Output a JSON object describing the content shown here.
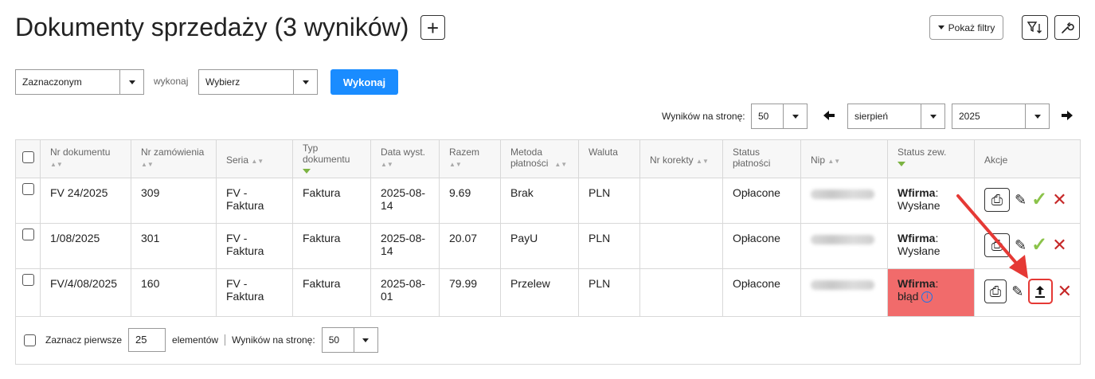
{
  "header": {
    "title": "Dokumenty sprzedaży (3 wyników)",
    "show_filters_label": "Pokaż filtry"
  },
  "bulk": {
    "scope_value": "Zaznaczonym",
    "action_label": "wykonaj",
    "action_value": "Wybierz",
    "execute_label": "Wykonaj"
  },
  "pager": {
    "per_page_label": "Wyników na stronę:",
    "per_page_value": "50",
    "month_value": "sierpień",
    "year_value": "2025"
  },
  "table": {
    "columns": [
      "Nr dokumentu",
      "Nr zamówienia",
      "Seria",
      "Typ dokumentu",
      "Data wyst.",
      "Razem",
      "Metoda płatności",
      "Waluta",
      "Nr korekty",
      "Status płatności",
      "Nip",
      "Status zew.",
      "Akcje"
    ],
    "rows": [
      {
        "doc": "FV 24/2025",
        "order": "309",
        "series": "FV - Faktura",
        "type": "Faktura",
        "date": "2025-08-14",
        "total": "9.69",
        "method": "Brak",
        "currency": "PLN",
        "correction": "",
        "pay_status": "Opłacone",
        "ext_label": "Wfirma",
        "ext_status": "Wysłane"
      },
      {
        "doc": "1/08/2025",
        "order": "301",
        "series": "FV - Faktura",
        "type": "Faktura",
        "date": "2025-08-14",
        "total": "20.07",
        "method": "PayU",
        "currency": "PLN",
        "correction": "",
        "pay_status": "Opłacone",
        "ext_label": "Wfirma",
        "ext_status": "Wysłane"
      },
      {
        "doc": "FV/4/08/2025",
        "order": "160",
        "series": "FV - Faktura",
        "type": "Faktura",
        "date": "2025-08-01",
        "total": "79.99",
        "method": "Przelew",
        "currency": "PLN",
        "correction": "",
        "pay_status": "Opłacone",
        "ext_label": "Wfirma",
        "ext_status": "błąd"
      }
    ]
  },
  "footer": {
    "select_first_label": "Zaznacz pierwsze",
    "select_first_value": "25",
    "elements_label": "elementów",
    "per_page_label": "Wyników na stronę:",
    "per_page_value": "50"
  },
  "colors": {
    "accent": "#1a8cff",
    "error_bg": "#f16b6b",
    "highlight": "#e53935",
    "check": "#8bc34a"
  }
}
